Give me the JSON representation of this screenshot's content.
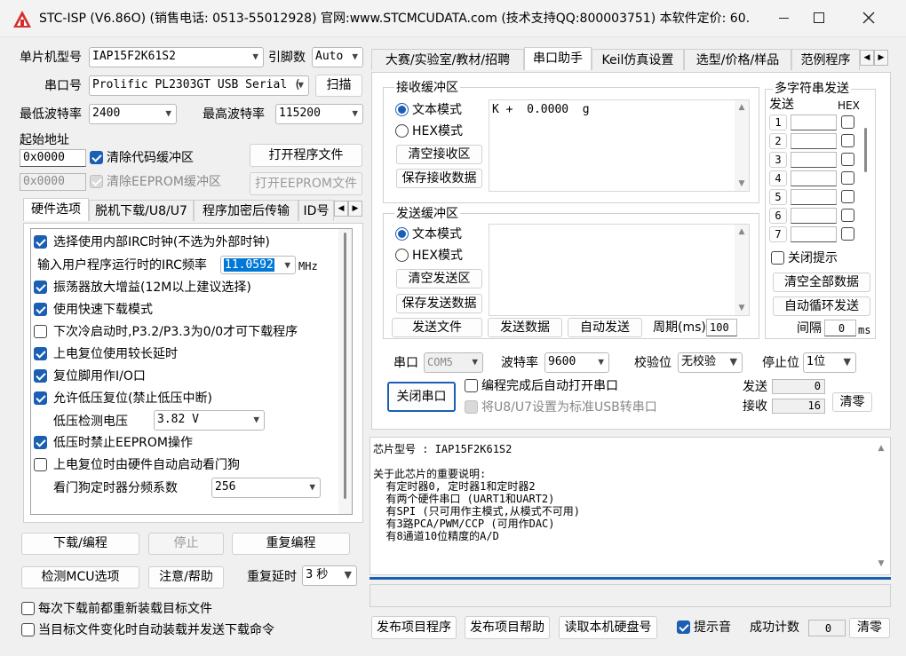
{
  "titlebar": {
    "title": "STC-ISP (V6.86O) (销售电话: 0513-55012928) 官网:www.STCMCUDATA.com  (技术支持QQ:800003751) 本软件定价: 60...",
    "icon": "stc-app-icon"
  },
  "left": {
    "chip_label": "单片机型号",
    "chip_value": "IAP15F2K61S2",
    "pins_label": "引脚数",
    "pins_value": "Auto",
    "port_label": "串口号",
    "port_value": "Prolific PL2303GT USB Serial (",
    "scan_button": "扫描",
    "min_baud_label": "最低波特率",
    "min_baud_value": "2400",
    "max_baud_label": "最高波特率",
    "max_baud_value": "115200",
    "start_addr_label": "起始地址",
    "code_addr": "0x0000",
    "clear_code_label": "清除代码缓冲区",
    "open_program_button": "打开程序文件",
    "eeprom_addr": "0x0000",
    "clear_eeprom_label": "清除EEPROM缓冲区",
    "open_eeprom_button": "打开EEPROM文件",
    "tabs": [
      "硬件选项",
      "脱机下载/U8/U7",
      "程序加密后传输",
      "ID号"
    ],
    "hw_options": [
      {
        "label": "选择使用内部IRC时钟(不选为外部时钟)",
        "checked": true
      },
      {
        "label": "振荡器放大增益(12M以上建议选择)",
        "checked": true
      },
      {
        "label": "使用快速下载模式",
        "checked": true
      },
      {
        "label": "下次冷启动时,P3.2/P3.3为0/0才可下载程序",
        "checked": false
      },
      {
        "label": "上电复位使用较长延时",
        "checked": true
      },
      {
        "label": "复位脚用作I/O口",
        "checked": true
      },
      {
        "label": "允许低压复位(禁止低压中断)",
        "checked": true
      },
      {
        "label": "低压时禁止EEPROM操作",
        "checked": true
      },
      {
        "label": "上电复位时由硬件自动启动看门狗",
        "checked": false
      }
    ],
    "irc_label": "输入用户程序运行时的IRC频率",
    "irc_value": "11.0592",
    "irc_unit": "MHz",
    "lowvolt_label": "低压检测电压",
    "lowvolt_value": "3.82 V",
    "wdt_label": "看门狗定时器分频系数",
    "wdt_value": "256",
    "download_button": "下载/编程",
    "stop_button": "停止",
    "reprogram_button": "重复编程",
    "check_mcu_button": "检测MCU选项",
    "help_button": "注意/帮助",
    "repeat_delay_label": "重复延时",
    "repeat_delay_value": "3 秒",
    "reload_label": "每次下载前都重新装载目标文件",
    "autoload_label": "当目标文件变化时自动装载并发送下载命令"
  },
  "right": {
    "tabs": [
      "大赛/实验室/教材/招聘",
      "串口助手",
      "Keil仿真设置",
      "选型/价格/样品",
      "范例程序"
    ],
    "recv_group": "接收缓冲区",
    "text_mode": "文本模式",
    "hex_mode": "HEX模式",
    "clear_recv": "清空接收区",
    "save_recv": "保存接收数据",
    "recv_content": "K +  0.0000  g",
    "send_group": "发送缓冲区",
    "clear_send": "清空发送区",
    "save_send": "保存发送数据",
    "send_file": "发送文件",
    "send_data": "发送数据",
    "auto_send": "自动发送",
    "period_label": "周期(ms)",
    "period_value": "100",
    "multi_group": "多字符串发送",
    "multi_send_header": "发送",
    "multi_hex_header": "HEX",
    "multi_rows": [
      "1",
      "2",
      "3",
      "4",
      "5",
      "6",
      "7"
    ],
    "close_tip": "关闭提示",
    "clear_all": "清空全部数据",
    "auto_loop": "自动循环发送",
    "interval_label": "间隔",
    "interval_value": "0",
    "interval_unit": "ms",
    "serial_label": "串口",
    "serial_value": "COM5",
    "baud_label": "波特率",
    "baud_value": "9600",
    "parity_label": "校验位",
    "parity_value": "无校验",
    "stop_label": "停止位",
    "stop_value": "1位",
    "close_port": "关闭串口",
    "auto_open_label": "编程完成后自动打开串口",
    "usb_label": "将U8/U7设置为标准USB转串口",
    "sent_label": "发送",
    "sent_value": "0",
    "recv_label": "接收",
    "recv_value": "16",
    "clear_counts": "清零",
    "info_lines": [
      "芯片型号 : IAP15F2K61S2",
      "",
      "关于此芯片的重要说明:",
      "  有定时器0, 定时器1和定时器2",
      "  有两个硬件串口 (UART1和UART2)",
      "  有SPI (只可用作主模式,从模式不可用)",
      "  有3路PCA/PWM/CCP (可用作DAC)",
      "  有8通道10位精度的A/D"
    ],
    "publish_program": "发布项目程序",
    "publish_help": "发布项目帮助",
    "read_disk": "读取本机硬盘号",
    "beep_label": "提示音",
    "success_label": "成功计数",
    "success_value": "0",
    "clear_success": "清零"
  }
}
